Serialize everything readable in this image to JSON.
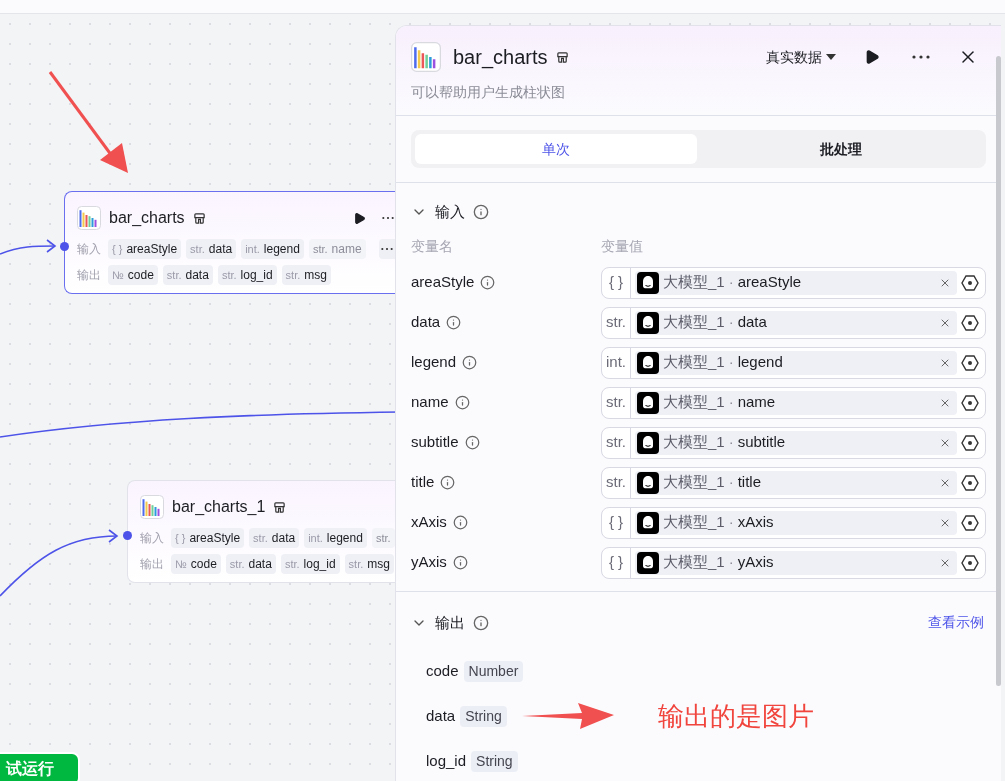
{
  "canvas": {
    "nodes": [
      {
        "title": "bar_charts",
        "selected": true,
        "inputs_label": "输入",
        "inputs": [
          {
            "type": "{ }",
            "name": "areaStyle",
            "faded": false
          },
          {
            "type": "str.",
            "name": "data",
            "faded": false
          },
          {
            "type": "int.",
            "name": "legend",
            "faded": false
          },
          {
            "type": "str.",
            "name": "name",
            "faded": true
          }
        ],
        "has_more_inputs": true,
        "outputs_label": "输出",
        "outputs": [
          {
            "type": "№",
            "name": "code"
          },
          {
            "type": "str.",
            "name": "data"
          },
          {
            "type": "str.",
            "name": "log_id"
          },
          {
            "type": "str.",
            "name": "msg"
          }
        ]
      },
      {
        "title": "bar_charts_1",
        "selected": false,
        "inputs_label": "输入",
        "inputs": [
          {
            "type": "{ }",
            "name": "areaStyle",
            "faded": false
          },
          {
            "type": "str.",
            "name": "data",
            "faded": false
          },
          {
            "type": "int.",
            "name": "legend",
            "faded": false
          },
          {
            "type": "str.",
            "faded": true
          }
        ],
        "has_more_inputs": false,
        "outputs_label": "输出",
        "outputs": [
          {
            "type": "№",
            "name": "code"
          },
          {
            "type": "str.",
            "name": "data"
          },
          {
            "type": "str.",
            "name": "log_id"
          },
          {
            "type": "str.",
            "name": "msg"
          }
        ]
      }
    ],
    "test_run_button": "试运行"
  },
  "panel": {
    "title": "bar_charts",
    "description": "可以帮助用户生成柱状图",
    "data_source": "真实数据",
    "tabs": [
      {
        "label": "单次",
        "selected": true
      },
      {
        "label": "批处理",
        "selected": false
      }
    ],
    "inputs": {
      "title": "输入",
      "expanded": true,
      "name_header": "变量名",
      "value_header": "变量值",
      "params": [
        {
          "name": "areaStyle",
          "type": "{ }",
          "source": "大模型_1",
          "separator": "·",
          "field": "areaStyle"
        },
        {
          "name": "data",
          "type": "str.",
          "source": "大模型_1",
          "separator": "·",
          "field": "data"
        },
        {
          "name": "legend",
          "type": "int.",
          "source": "大模型_1",
          "separator": "·",
          "field": "legend"
        },
        {
          "name": "name",
          "type": "str.",
          "source": "大模型_1",
          "separator": "·",
          "field": "name"
        },
        {
          "name": "subtitle",
          "type": "str.",
          "source": "大模型_1",
          "separator": "·",
          "field": "subtitle"
        },
        {
          "name": "title",
          "type": "str.",
          "source": "大模型_1",
          "separator": "·",
          "field": "title"
        },
        {
          "name": "xAxis",
          "type": "{ }",
          "source": "大模型_1",
          "separator": "·",
          "field": "xAxis"
        },
        {
          "name": "yAxis",
          "type": "{ }",
          "source": "大模型_1",
          "separator": "·",
          "field": "yAxis"
        }
      ]
    },
    "outputs": {
      "title": "输出",
      "expanded": true,
      "link": "查看示例",
      "items": [
        {
          "name": "code",
          "type": "Number"
        },
        {
          "name": "data",
          "type": "String"
        },
        {
          "name": "log_id",
          "type": "String"
        }
      ]
    },
    "annotation": "输出的是图片"
  }
}
